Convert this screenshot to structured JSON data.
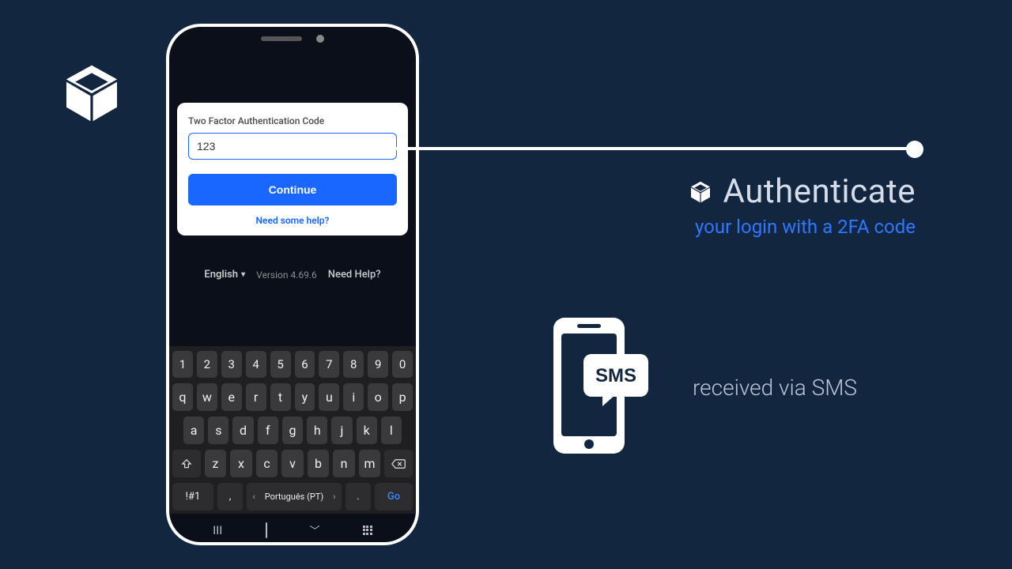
{
  "logo": {
    "name": "cube-logo"
  },
  "phone": {
    "dialog": {
      "label": "Two Factor Authentication Code",
      "code_value": "123",
      "continue_label": "Continue",
      "help_label": "Need some help?"
    },
    "meta": {
      "language": "English",
      "version": "Version 4.69.6",
      "need_help": "Need Help?"
    },
    "keyboard": {
      "row_num": [
        "1",
        "2",
        "3",
        "4",
        "5",
        "6",
        "7",
        "8",
        "9",
        "0"
      ],
      "row_q": [
        "q",
        "w",
        "e",
        "r",
        "t",
        "y",
        "u",
        "i",
        "o",
        "p"
      ],
      "row_a": [
        "a",
        "s",
        "d",
        "f",
        "g",
        "h",
        "j",
        "k",
        "l"
      ],
      "row_z": [
        "z",
        "x",
        "c",
        "v",
        "b",
        "n",
        "m"
      ],
      "sym_label": "!#1",
      "comma_label": ",",
      "lang_label": "Português (PT)",
      "dot_label": ".",
      "go_label": "Go"
    }
  },
  "headline": {
    "title": "Authenticate",
    "subtitle": "your login with a 2FA code"
  },
  "sms": {
    "badge": "SMS",
    "text": "received via SMS"
  }
}
